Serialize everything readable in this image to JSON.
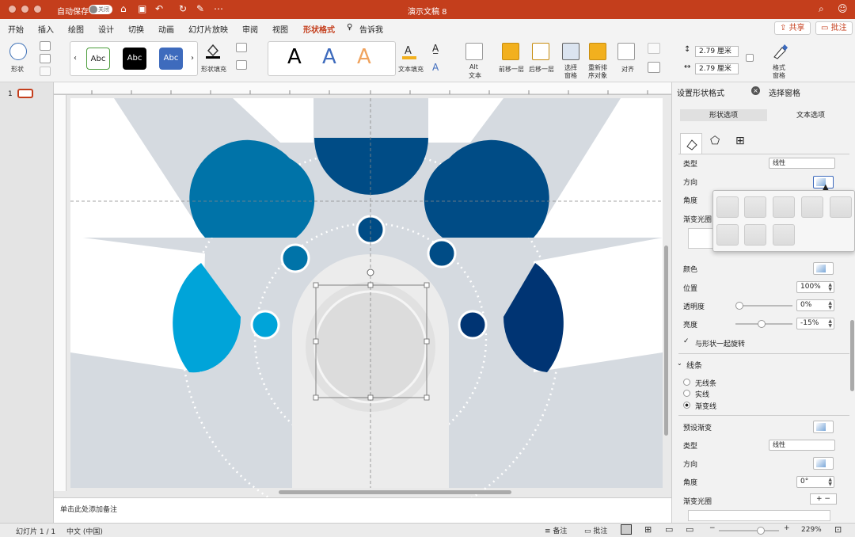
{
  "window": {
    "title": "演示文稿 8",
    "autosave_label": "自动保存",
    "autosave_state": "关闭"
  },
  "menu": {
    "tabs": [
      "开始",
      "插入",
      "绘图",
      "设计",
      "切换",
      "动画",
      "幻灯片放映",
      "审阅",
      "视图",
      "形状格式",
      "告诉我"
    ],
    "active_tab": "形状格式",
    "share": "共享",
    "comment": "批注"
  },
  "ribbon": {
    "shape_label": "形状",
    "styles": [
      "Abc",
      "Abc",
      "Abc"
    ],
    "fill_label": "形状填充",
    "wordart": [
      "A",
      "A",
      "A"
    ],
    "text_fill_label": "文本填充",
    "alt_text_label1": "Alt",
    "alt_text_label2": "文本",
    "bring_forward": "前移一层",
    "send_backward": "后移一层",
    "selection_pane1": "选择",
    "selection_pane2": "窗格",
    "reorder1": "重新排",
    "reorder2": "序对象",
    "align": "对齐",
    "height": "2.79 厘米",
    "width": "2.79 厘米",
    "format_pane1": "格式",
    "format_pane2": "窗格"
  },
  "thumbs": {
    "number": "1"
  },
  "notes": {
    "placeholder": "单击此处添加备注"
  },
  "status": {
    "slide": "幻灯片 1 / 1",
    "lang": "中文 (中国)",
    "notes_btn": "备注",
    "comments_btn": "批注",
    "zoom": "229%"
  },
  "panel": {
    "title": "设置形状格式",
    "tab2": "选择窗格",
    "sub_shape": "形状选项",
    "sub_text": "文本选项",
    "type_label": "类型",
    "type_value": "线性",
    "direction_label": "方向",
    "angle_label": "角度",
    "stops_label": "渐变光圈",
    "color_label": "颜色",
    "position_label": "位置",
    "position_value": "100%",
    "transparency_label": "透明度",
    "transparency_value": "0%",
    "brightness_label": "亮度",
    "brightness_value": "-15%",
    "rotate_label": "与形状一起旋转",
    "line_section": "线条",
    "no_line": "无线条",
    "solid_line": "实线",
    "gradient_line": "渐变线",
    "preset_label": "预设渐变",
    "type2_label": "类型",
    "type2_value": "线性",
    "direction2_label": "方向",
    "angle2_label": "角度",
    "angle2_value": "0°",
    "stops2_label": "渐变光圈"
  },
  "colors": {
    "accent": "#c43e1c",
    "petal_light": "#00a4d9",
    "petal_mid": "#0073a8",
    "petal_dark": "#004c86",
    "petal_darkest": "#003473"
  }
}
